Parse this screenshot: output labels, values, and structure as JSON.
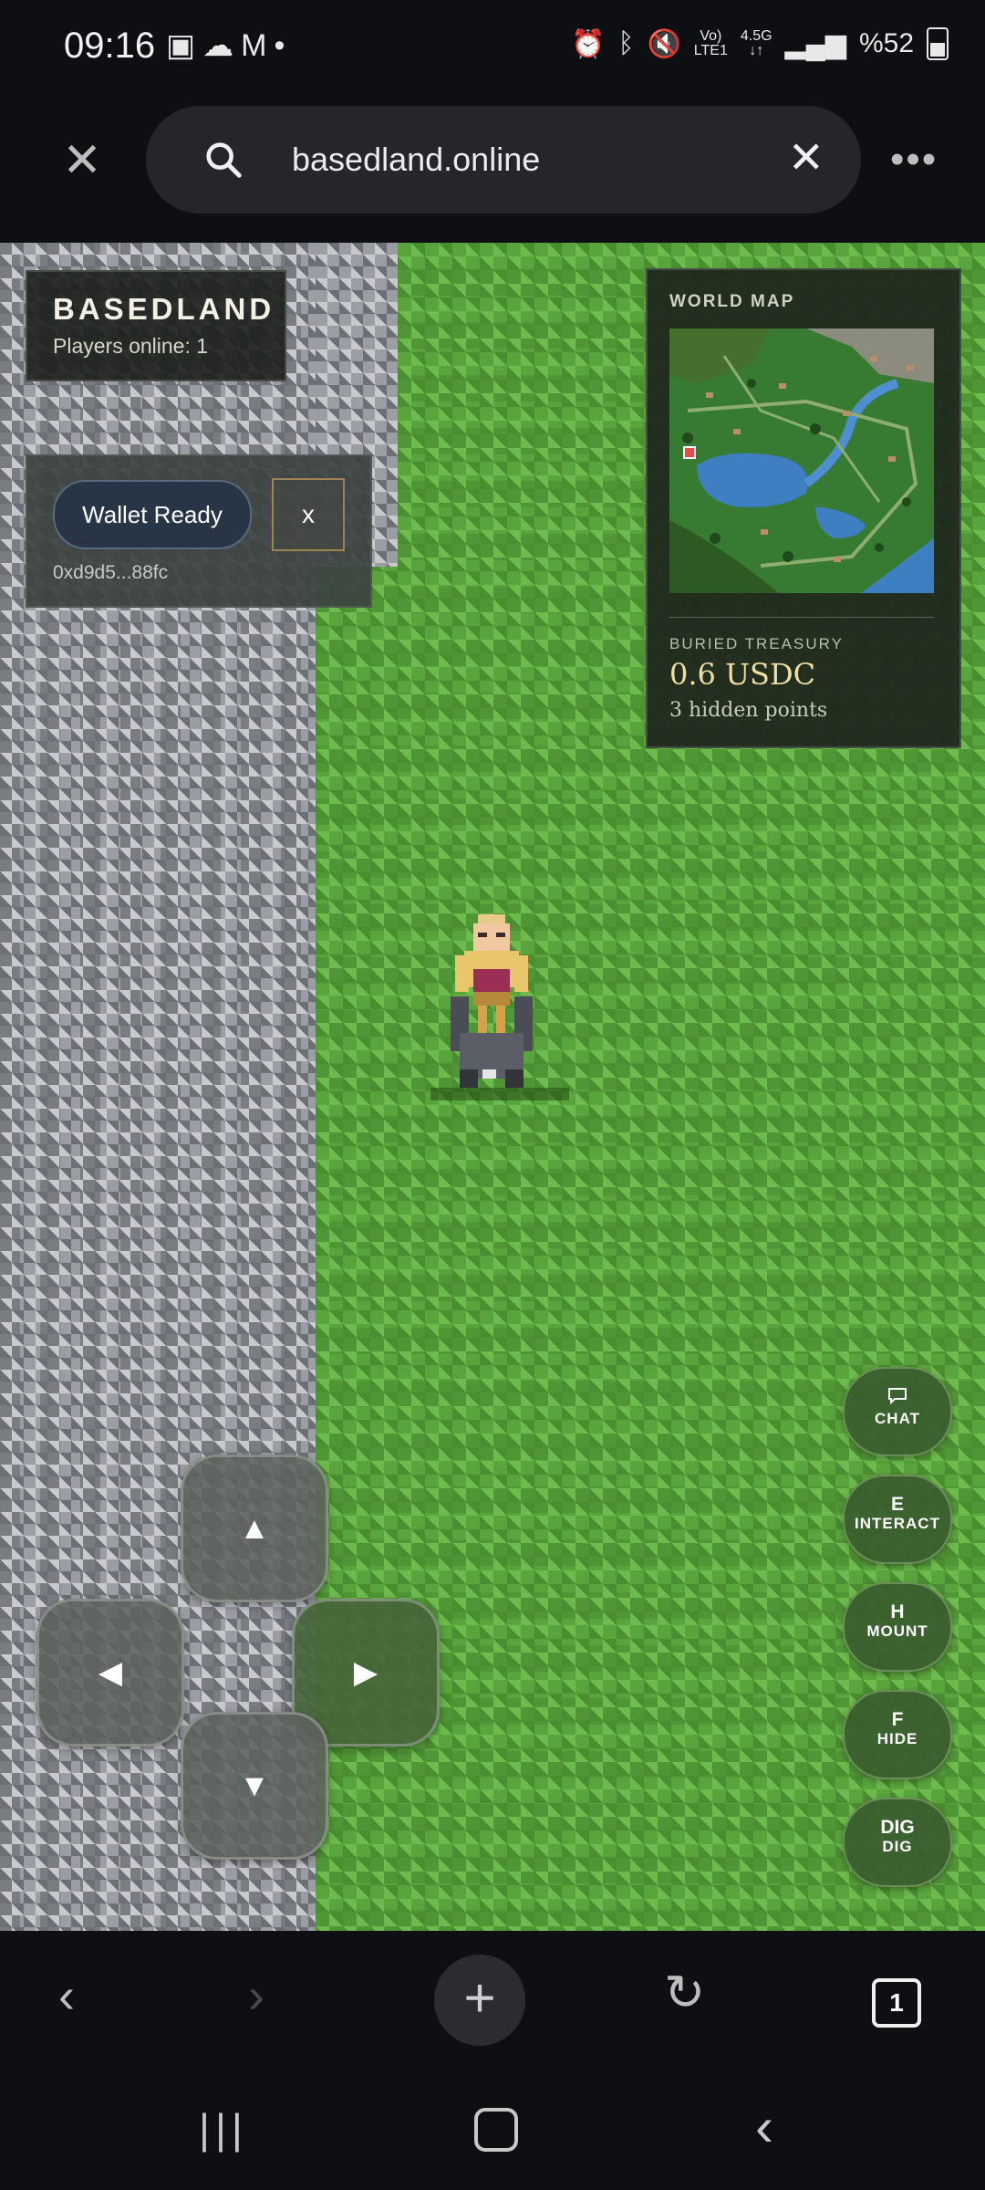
{
  "status_bar": {
    "time": "09:16",
    "battery": "%52",
    "network_top": "Vo)",
    "network_bottom": "LTE1",
    "data_top": "4.5G",
    "data_bottom": "↓↑"
  },
  "browser": {
    "url": "basedland.online"
  },
  "game": {
    "title": "BASEDLAND",
    "players_online": "Players online: 1",
    "wallet": {
      "button": "Wallet Ready",
      "close": "x",
      "address": "0xd9d5...88fc"
    },
    "world_map": {
      "label": "WORLD MAP"
    },
    "treasury": {
      "label": "BURIED TREASURY",
      "value": "0.6 USDC",
      "points": "3 hidden points"
    },
    "dpad": {
      "up": "▲",
      "down": "▼",
      "left": "◀",
      "right": "▶"
    },
    "actions": [
      {
        "key": "",
        "label": "CHAT"
      },
      {
        "key": "E",
        "label": "INTERACT"
      },
      {
        "key": "H",
        "label": "MOUNT"
      },
      {
        "key": "F",
        "label": "HIDE"
      },
      {
        "key": "DIG",
        "label": "DIG"
      }
    ]
  },
  "bottom_nav": {
    "tabs_count": "1"
  },
  "colors": {
    "accent_gold": "#f0dfa0",
    "grass": "#5aa43d",
    "wallet_button": "#273546"
  }
}
